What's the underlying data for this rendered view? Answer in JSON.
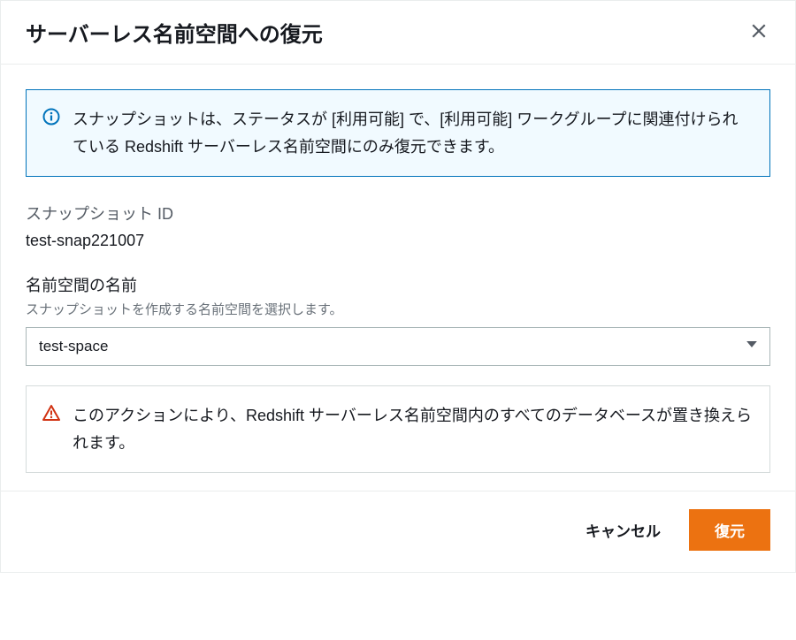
{
  "modal": {
    "title": "サーバーレス名前空間への復元"
  },
  "info": {
    "message": "スナップショットは、ステータスが [利用可能] で、[利用可能] ワークグループに関連付けられている Redshift サーバーレス名前空間にのみ復元できます。"
  },
  "snapshot": {
    "label": "スナップショット ID",
    "value": "test-snap221007"
  },
  "namespace": {
    "label": "名前空間の名前",
    "hint": "スナップショットを作成する名前空間を選択します。",
    "selected": "test-space"
  },
  "warning": {
    "message": "このアクションにより、Redshift サーバーレス名前空間内のすべてのデータベースが置き換えられます。"
  },
  "footer": {
    "cancel": "キャンセル",
    "confirm": "復元"
  }
}
